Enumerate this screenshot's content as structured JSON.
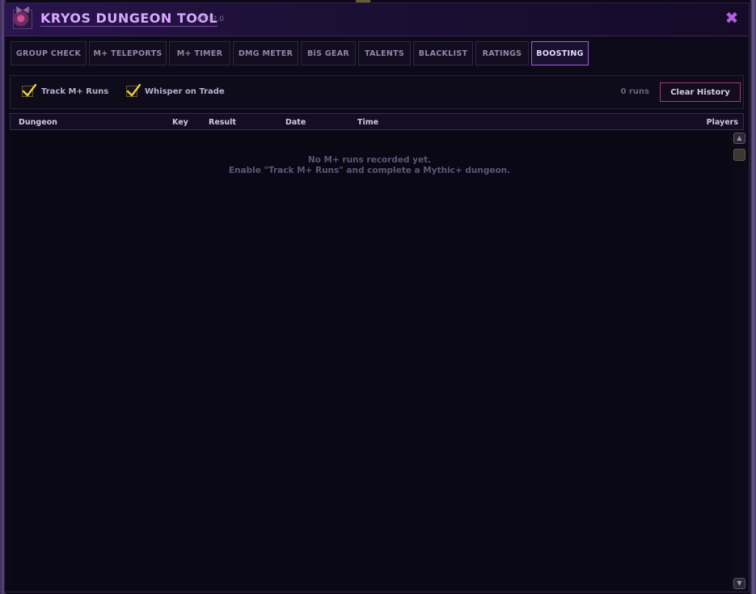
{
  "app": {
    "title": "KRYOS DUNGEON TOOL",
    "version": "v2.12.0",
    "close_glyph": "✖"
  },
  "tabs": [
    {
      "label": "GROUP CHECK",
      "active": false
    },
    {
      "label": "M+ TELEPORTS",
      "active": false
    },
    {
      "label": "M+ TIMER",
      "active": false
    },
    {
      "label": "DMG METER",
      "active": false
    },
    {
      "label": "BiS GEAR",
      "active": false
    },
    {
      "label": "TALENTS",
      "active": false
    },
    {
      "label": "BLACKLIST",
      "active": false
    },
    {
      "label": "RATINGS",
      "active": false
    },
    {
      "label": "BOOSTING",
      "active": true
    }
  ],
  "toolbar": {
    "track_runs": {
      "label": "Track M+ Runs",
      "checked": true
    },
    "whisper_trade": {
      "label": "Whisper on Trade",
      "checked": true
    },
    "runs_count": "0 runs",
    "clear_label": "Clear History"
  },
  "table": {
    "columns": [
      "Dungeon",
      "Key",
      "Result",
      "Date",
      "Time",
      "Players"
    ],
    "rows": []
  },
  "empty_state": {
    "line1": "No M+ runs recorded yet.",
    "line2": "Enable \"Track M+ Runs\" and complete a Mythic+ dungeon."
  },
  "scrollbar": {
    "up_icon": "scroll-up-icon",
    "down_icon": "scroll-down-icon"
  },
  "colors": {
    "accent": "#d9a8ff",
    "active_tab_border": "#a060e0",
    "clear_border": "#a03a78",
    "close": "#b060e0",
    "check": "#e8d040"
  }
}
